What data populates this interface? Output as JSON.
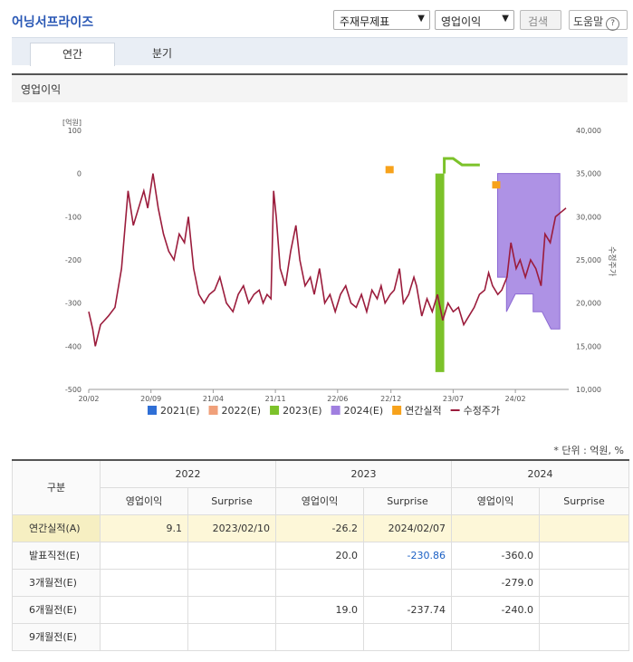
{
  "header": {
    "title": "어닝서프라이즈",
    "select1": "주재무제표",
    "select2": "영업이익",
    "search_label": "검색",
    "help_label": "도움말",
    "help_icon": "?"
  },
  "tabs": [
    {
      "label": "연간"
    },
    {
      "label": "분기"
    }
  ],
  "section_title": "영업이익",
  "chart_data": {
    "type": "line",
    "y_left_unit": "[억원]",
    "y_left_ticks": [
      "100",
      "0",
      "-100",
      "-200",
      "-300",
      "-400",
      "-500"
    ],
    "y_right_label": "수정주가",
    "y_right_ticks": [
      "40,000",
      "35,000",
      "30,000",
      "25,000",
      "20,000",
      "15,000",
      "10,000"
    ],
    "x_ticks": [
      "20/02",
      "20/09",
      "21/04",
      "21/11",
      "22/06",
      "22/12",
      "23/07",
      "24/02"
    ],
    "ylim_left": [
      -500,
      100
    ],
    "ylim_right": [
      10000,
      40000
    ],
    "legend": [
      {
        "label": "2021(E)",
        "color": "#2f6fd6"
      },
      {
        "label": "2022(E)",
        "color": "#f0a07a"
      },
      {
        "label": "2023(E)",
        "color": "#7cc22a"
      },
      {
        "label": "2024(E)",
        "color": "#a07fe0"
      },
      {
        "label": "연간실적",
        "color": "#f7a21b"
      },
      {
        "label": "수정주가",
        "color": "#9b1c3c"
      }
    ],
    "series": [
      {
        "name": "2022(E)",
        "points": [
          [
            "22/12",
            9.1
          ]
        ]
      },
      {
        "name": "2023(E)",
        "points": [
          [
            "23/05",
            -460
          ],
          [
            "23/06",
            -460
          ],
          [
            "23/06",
            35
          ],
          [
            "23/07",
            35
          ],
          [
            "23/08",
            20
          ],
          [
            "23/09",
            20
          ],
          [
            "23/10",
            20
          ]
        ]
      },
      {
        "name": "2024(E)",
        "points": [
          [
            "23/12",
            0
          ],
          [
            "24/07",
            0
          ],
          [
            "24/07",
            -360
          ]
        ]
      },
      {
        "name": "연간실적",
        "points": [
          [
            "22/12",
            9.1
          ],
          [
            "23/12",
            -26.2
          ]
        ]
      }
    ],
    "price_series": {
      "name": "수정주가"
    }
  },
  "table": {
    "unit_note": "* 단위 : 억원, %",
    "corner": "구분",
    "years": [
      "2022",
      "2023",
      "2024"
    ],
    "sub_headers": [
      "영업이익",
      "Surprise",
      "영업이익",
      "Surprise",
      "영업이익",
      "Surprise"
    ],
    "rows": [
      {
        "label": "연간실적(A)",
        "cells": [
          "9.1",
          "2023/02/10",
          "-26.2",
          "2024/02/07",
          "",
          ""
        ]
      },
      {
        "label": "발표직전(E)",
        "cells": [
          "",
          "",
          "20.0",
          "-230.86",
          "-360.0",
          ""
        ]
      },
      {
        "label": "3개월전(E)",
        "cells": [
          "",
          "",
          "",
          "",
          "-279.0",
          ""
        ]
      },
      {
        "label": "6개월전(E)",
        "cells": [
          "",
          "",
          "19.0",
          "-237.74",
          "-240.0",
          ""
        ]
      },
      {
        "label": "9개월전(E)",
        "cells": [
          "",
          "",
          "",
          "",
          "",
          ""
        ]
      }
    ]
  }
}
